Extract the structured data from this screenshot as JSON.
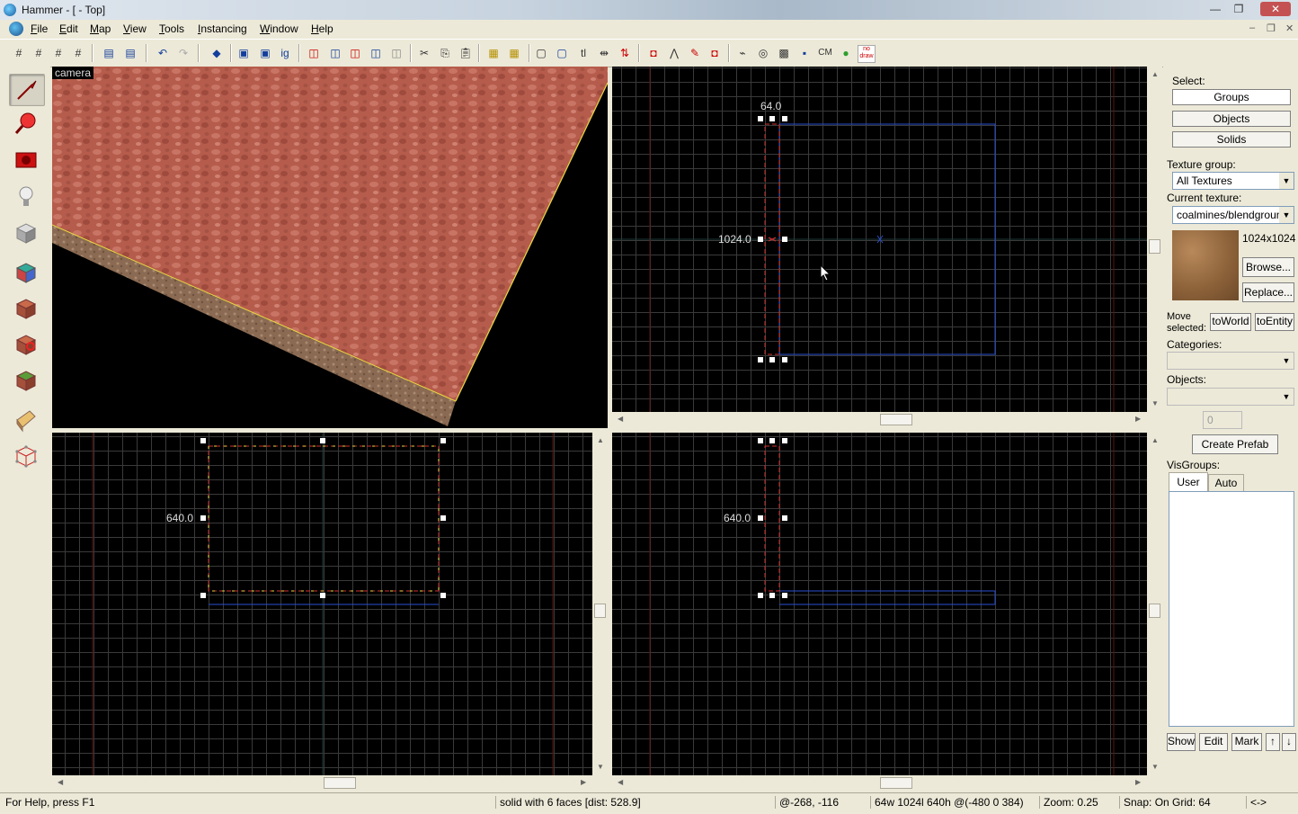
{
  "window": {
    "title": "Hammer - [ - Top]",
    "minimize": "—",
    "restore": "❐",
    "close": "✕"
  },
  "menu": {
    "items": [
      "File",
      "Edit",
      "Map",
      "View",
      "Tools",
      "Instancing",
      "Window",
      "Help"
    ],
    "mdi_minimize": "–",
    "mdi_restore": "❐",
    "mdi_close": "✕"
  },
  "toolbar": {
    "cm_label": "CM",
    "nodraw_label": "no draw"
  },
  "viewports": {
    "camera_label": "camera",
    "top": {
      "width_label": "64.0",
      "height_label": "1024.0"
    },
    "front": {
      "height_label": "640.0"
    },
    "side": {
      "height_label": "640.0"
    }
  },
  "right_panel": {
    "select_label": "Select:",
    "groups_button": "Groups",
    "objects_button": "Objects",
    "solids_button": "Solids",
    "texture_group_label": "Texture group:",
    "texture_group_value": "All Textures",
    "current_texture_label": "Current texture:",
    "current_texture_value": "coalmines/blendground",
    "texture_size": "1024x1024",
    "browse_button": "Browse...",
    "replace_button": "Replace...",
    "move_selected_label": "Move selected:",
    "to_world_button": "toWorld",
    "to_entity_button": "toEntity",
    "categories_label": "Categories:",
    "objects_label": "Objects:",
    "objects_count": "0",
    "create_prefab_button": "Create Prefab",
    "visgroups_label": "VisGroups:",
    "visgroup_tabs": [
      "User",
      "Auto"
    ],
    "show_button": "Show",
    "edit_button": "Edit",
    "mark_button": "Mark"
  },
  "status": {
    "help": "For Help, press F1",
    "selection": "solid with 6 faces   [dist: 528.9]",
    "cursor": "@-268, -116",
    "size": "64w 1024l 640h @(-480 0 384)",
    "zoom": "Zoom: 0.25",
    "snap": "Snap: On Grid: 64",
    "extra": "<->"
  },
  "colors": {
    "selection_red": "#d23030",
    "selection_yellow": "#e8d840",
    "brush_blue": "#2a4fd0",
    "axis_red": "#5a1414",
    "terrain": "#b2584a"
  }
}
